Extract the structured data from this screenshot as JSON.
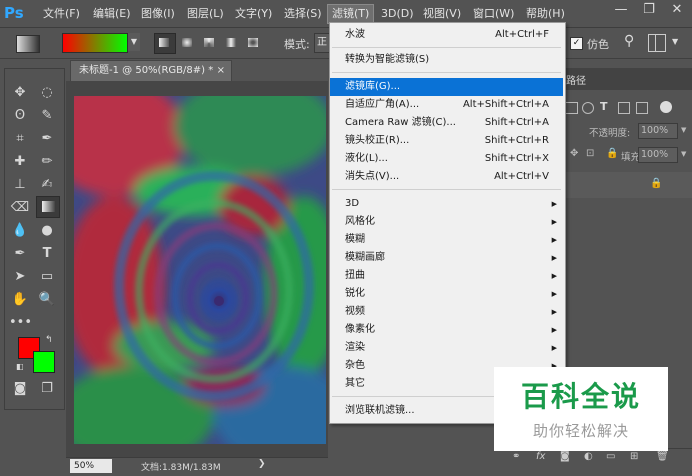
{
  "app": {
    "logo": "Ps"
  },
  "menubar": {
    "items": [
      "文件(F)",
      "编辑(E)",
      "图像(I)",
      "图层(L)",
      "文字(Y)",
      "选择(S)",
      "滤镜(T)",
      "3D(D)",
      "视图(V)",
      "窗口(W)",
      "帮助(H)"
    ],
    "active": "滤镜(T)",
    "minimize": "—",
    "restore": "❐",
    "close": "✕"
  },
  "options": {
    "mode_label": "模式:",
    "mode_value": "正",
    "fake_label": "仿色"
  },
  "document": {
    "tab_title": "未标题-1 @ 50%(RGB/8#) *",
    "tab_close": "×",
    "zoom": "50%",
    "doc_info": "文档:1.83M/1.83M"
  },
  "panels": {
    "tab_label": "路径",
    "opacity_label": "不透明度:",
    "opacity_value": "100%",
    "fill_label": "填充:",
    "fill_value": "100%"
  },
  "filter_menu": {
    "items": [
      {
        "label": "水波",
        "shortcut": "Alt+Ctrl+F"
      },
      {
        "label": "转换为智能滤镜(S)",
        "shortcut": ""
      },
      {
        "label": "滤镜库(G)...",
        "shortcut": ""
      },
      {
        "label": "自适应广角(A)...",
        "shortcut": "Alt+Shift+Ctrl+A"
      },
      {
        "label": "Camera Raw 滤镜(C)...",
        "shortcut": "Shift+Ctrl+A"
      },
      {
        "label": "镜头校正(R)...",
        "shortcut": "Shift+Ctrl+R"
      },
      {
        "label": "液化(L)...",
        "shortcut": "Shift+Ctrl+X"
      },
      {
        "label": "消失点(V)...",
        "shortcut": "Alt+Ctrl+V"
      },
      {
        "label": "3D",
        "shortcut": ""
      },
      {
        "label": "风格化",
        "shortcut": ""
      },
      {
        "label": "模糊",
        "shortcut": ""
      },
      {
        "label": "模糊画廊",
        "shortcut": ""
      },
      {
        "label": "扭曲",
        "shortcut": ""
      },
      {
        "label": "锐化",
        "shortcut": ""
      },
      {
        "label": "视频",
        "shortcut": ""
      },
      {
        "label": "像素化",
        "shortcut": ""
      },
      {
        "label": "渲染",
        "shortcut": ""
      },
      {
        "label": "杂色",
        "shortcut": ""
      },
      {
        "label": "其它",
        "shortcut": ""
      },
      {
        "label": "浏览联机滤镜...",
        "shortcut": ""
      }
    ],
    "highlighted": "滤镜库(G)..."
  },
  "colors": {
    "foreground": "#ff0000",
    "background": "#00ff00",
    "highlight": "#0a72d6"
  },
  "watermark": {
    "title": "百科全说",
    "subtitle": "助你轻松解决"
  }
}
